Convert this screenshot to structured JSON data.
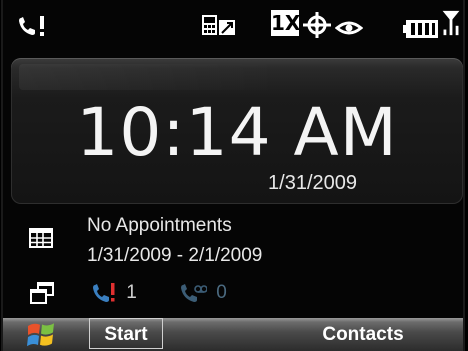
{
  "status_bar": {
    "network_label": "1X",
    "icons": [
      "phone-signal-icon",
      "data-connection-icon",
      "1x-network-icon",
      "gps-icon",
      "eye-icon",
      "battery-icon",
      "signal-strength-icon"
    ]
  },
  "clock": {
    "time": "10:14 AM",
    "date": "1/31/2009"
  },
  "appointments": {
    "title": "No Appointments",
    "range": "1/31/2009 - 2/1/2009"
  },
  "notifications": {
    "missed_calls": "1",
    "voicemail": "0"
  },
  "softkeys": {
    "left": "Start",
    "right": "Contacts"
  },
  "colors": {
    "background": "#050505",
    "voicemail": "#4b6a80",
    "missed_call_icon": "#e03030",
    "phone_icon": "#3a7fc0"
  }
}
